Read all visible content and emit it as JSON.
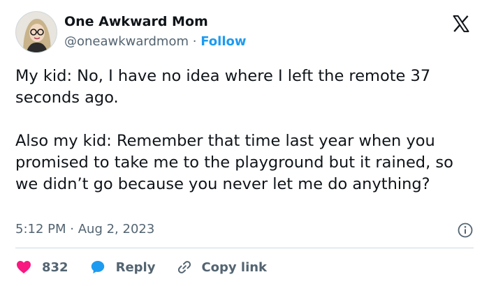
{
  "author": {
    "name": "One Awkward Mom",
    "handle": "@oneawkwardmom",
    "separator": "·",
    "follow_label": "Follow",
    "avatar_icon": "avatar-woman-glasses"
  },
  "brand": {
    "logo_icon": "x-logo",
    "color": "#0f1419"
  },
  "tweet": {
    "paragraph1": "My kid: No, I have no idea where I left the remote 37 seconds ago.",
    "paragraph2": "Also my kid: Remember that time last year when you promised to take me to the playground but it rained, so we didn’t go because you never let me do anything?"
  },
  "meta": {
    "time": "5:12 PM",
    "separator": "·",
    "date": "Aug 2, 2023",
    "info_icon": "info-icon"
  },
  "actions": {
    "like_icon": "heart-icon",
    "like_count": "832",
    "reply_icon": "reply-bubble-icon",
    "reply_label": "Reply",
    "copy_icon": "link-icon",
    "copy_label": "Copy link"
  },
  "colors": {
    "like": "#f91880",
    "reply": "#1d9bf0",
    "follow": "#1d9bf0",
    "secondary_text": "#536471",
    "divider": "#cfd9de"
  }
}
